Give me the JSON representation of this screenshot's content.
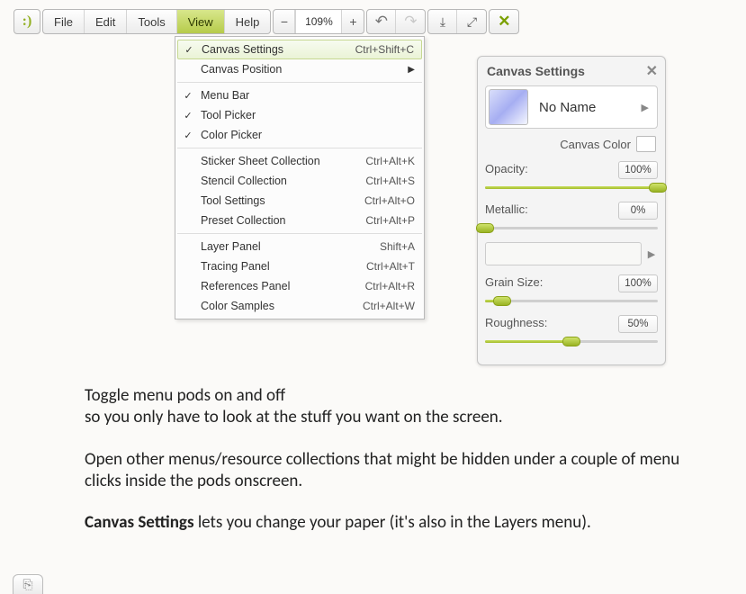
{
  "toolbar": {
    "menus": [
      "File",
      "Edit",
      "Tools",
      "View",
      "Help"
    ],
    "active_menu_index": 3,
    "zoom": "109%"
  },
  "dropdown": {
    "sections": [
      [
        {
          "check": true,
          "label": "Canvas Settings",
          "shortcut": "Ctrl+Shift+C",
          "highlight": true
        },
        {
          "check": false,
          "label": "Canvas Position",
          "submenu": true
        }
      ],
      [
        {
          "check": true,
          "label": "Menu Bar"
        },
        {
          "check": true,
          "label": "Tool Picker"
        },
        {
          "check": true,
          "label": "Color Picker"
        }
      ],
      [
        {
          "check": false,
          "label": "Sticker Sheet Collection",
          "shortcut": "Ctrl+Alt+K"
        },
        {
          "check": false,
          "label": "Stencil Collection",
          "shortcut": "Ctrl+Alt+S"
        },
        {
          "check": false,
          "label": "Tool Settings",
          "shortcut": "Ctrl+Alt+O"
        },
        {
          "check": false,
          "label": "Preset Collection",
          "shortcut": "Ctrl+Alt+P"
        }
      ],
      [
        {
          "check": false,
          "label": "Layer Panel",
          "shortcut": "Shift+A"
        },
        {
          "check": false,
          "label": "Tracing Panel",
          "shortcut": "Ctrl+Alt+T"
        },
        {
          "check": false,
          "label": "References Panel",
          "shortcut": "Ctrl+Alt+R"
        },
        {
          "check": false,
          "label": "Color Samples",
          "shortcut": "Ctrl+Alt+W"
        }
      ]
    ]
  },
  "pod": {
    "title": "Canvas Settings",
    "preset_name": "No Name",
    "canvas_color_label": "Canvas Color",
    "params": [
      {
        "label": "Opacity:",
        "value": "100%",
        "pct": 100
      },
      {
        "label": "Metallic:",
        "value": "0%",
        "pct": 0
      },
      {
        "label": "Grain Size:",
        "value": "100%",
        "pct": 10
      },
      {
        "label": "Roughness:",
        "value": "50%",
        "pct": 50
      }
    ]
  },
  "copy": {
    "p1": "Toggle menu pods on and off\nso you only have to look at the stuff you want on the screen.",
    "p2": "Open other menus/resource collections that might be hidden under a couple of menu clicks inside the pods onscreen.",
    "p3a": "Canvas Settings",
    "p3b": " lets you change your paper (it's also in the Layers menu)."
  }
}
